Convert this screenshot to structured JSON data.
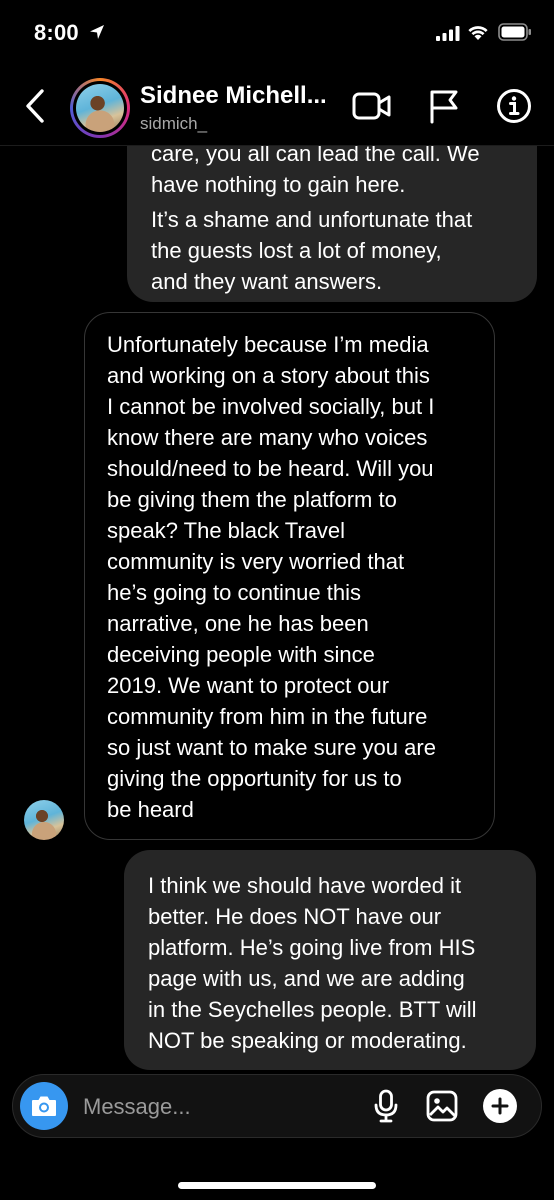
{
  "status_bar": {
    "time": "8:00",
    "icons": [
      "location-arrow-icon",
      "cellular-signal-icon",
      "wifi-icon",
      "battery-icon"
    ]
  },
  "header": {
    "contact_name": "Sidnee Michell...",
    "username": "sidmich_",
    "icons": [
      "back-chevron-icon",
      "video-call-icon",
      "flag-icon",
      "info-icon"
    ]
  },
  "messages": [
    {
      "direction": "sent",
      "clipped_first_line": "care, you all can lead the call. We",
      "lines": "have nothing to gain here.",
      "second_paragraph": "It’s a shame and unfortunate that\nthe guests lost a lot of money,\nand they want answers."
    },
    {
      "direction": "received",
      "text": "Unfortunately because I’m media\nand working on a story about this\nI cannot be involved socially, but I\nknow there are many who voices\nshould/need to be heard. Will you\nbe giving them the platform to\nspeak? The black Travel\ncommunity is very worried that\nhe’s going to continue this\nnarrative, one he has been\ndeceiving people with since\n2019. We want to protect our\ncommunity from him in the future\nso just want to make sure you are\ngiving the opportunity for us to\nbe heard"
    },
    {
      "direction": "sent",
      "text": "I think we should have worded it\nbetter. He does NOT have our\nplatform. He’s going live from HIS\npage with us, and we are adding\nin the Seychelles people. BTT will\nNOT be speaking or moderating."
    }
  ],
  "composer": {
    "placeholder": "Message...",
    "value": "",
    "icons": [
      "camera-icon",
      "microphone-icon",
      "gallery-icon",
      "plus-icon"
    ],
    "camera_color": "#3797f0"
  },
  "colors": {
    "background": "#000000",
    "sent_bubble": "#262626",
    "received_border": "#363636",
    "secondary_text": "#a8a8a8"
  }
}
